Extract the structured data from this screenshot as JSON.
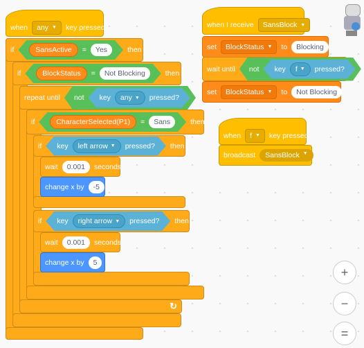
{
  "script_key": {
    "hat": {
      "when": "when",
      "key": "any",
      "suffix": "key pressed"
    },
    "if1": {
      "label": "if",
      "var": "SansActive",
      "eq": "=",
      "value": "Yes",
      "then": "then"
    },
    "if2": {
      "label": "if",
      "var": "BlockStatus",
      "eq": "=",
      "value": "Not Blocking",
      "then": "then"
    },
    "repeat": {
      "label": "repeat until",
      "not": "not",
      "key": "key",
      "key_value": "any",
      "pressed": "pressed?"
    },
    "if3": {
      "label": "if",
      "var": "CharacterSelected(P1)",
      "eq": "=",
      "value": "Sans",
      "then": "then"
    },
    "if_left": {
      "label": "if",
      "key": "key",
      "key_value": "left arrow",
      "pressed": "pressed?",
      "then": "then",
      "wait": {
        "label": "wait",
        "value": "0.001",
        "unit": "seconds"
      },
      "change": {
        "label": "change x by",
        "value": "-5"
      }
    },
    "if_right": {
      "label": "if",
      "key": "key",
      "key_value": "right arrow",
      "pressed": "pressed?",
      "then": "then",
      "wait": {
        "label": "wait",
        "value": "0.001",
        "unit": "seconds"
      },
      "change": {
        "label": "change x by",
        "value": "5"
      }
    }
  },
  "script_receive": {
    "hat": {
      "label": "when I receive",
      "message": "SansBlock"
    },
    "set1": {
      "label": "set",
      "var": "BlockStatus",
      "to": "to",
      "value": "Blocking"
    },
    "wait_until": {
      "label": "wait until",
      "not": "not",
      "key": "key",
      "key_value": "f",
      "pressed": "pressed?"
    },
    "set2": {
      "label": "set",
      "var": "BlockStatus",
      "to": "to",
      "value": "Not Blocking"
    }
  },
  "script_f": {
    "hat": {
      "when": "when",
      "key": "f",
      "suffix": "key pressed"
    },
    "broadcast": {
      "label": "broadcast",
      "message": "SansBlock"
    }
  },
  "icons": {
    "dropdown": "▼",
    "loop": "↻",
    "zoom_in": "+",
    "zoom_out": "−",
    "reset": "="
  }
}
